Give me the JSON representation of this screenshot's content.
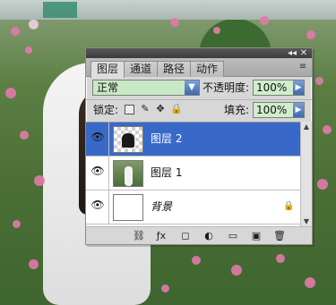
{
  "window": {
    "title_buttons": {
      "collapse": "◂◂",
      "close": "✕"
    }
  },
  "tabs": [
    {
      "label": "图层"
    },
    {
      "label": "通道"
    },
    {
      "label": "路径"
    },
    {
      "label": "动作"
    }
  ],
  "blend": {
    "mode": "正常",
    "opacity_label": "不透明度:",
    "opacity_value": "100%"
  },
  "lock": {
    "label": "锁定:",
    "fill_label": "填充:",
    "fill_value": "100%"
  },
  "layers": [
    {
      "name": "图层 2",
      "selected": true,
      "visible": true,
      "thumb": "transparent-silhouette"
    },
    {
      "name": "图层 1",
      "selected": false,
      "visible": true,
      "thumb": "photo"
    },
    {
      "name": "背景",
      "selected": false,
      "visible": true,
      "thumb": "white",
      "locked": true
    }
  ],
  "icons": {
    "eye": "eye-icon",
    "lock": "lock-icon",
    "menu": "panel-menu-icon"
  },
  "colors": {
    "selection": "#3969c8",
    "field_green": "#cfeecb",
    "panel_bg": "#d7d7d7"
  }
}
